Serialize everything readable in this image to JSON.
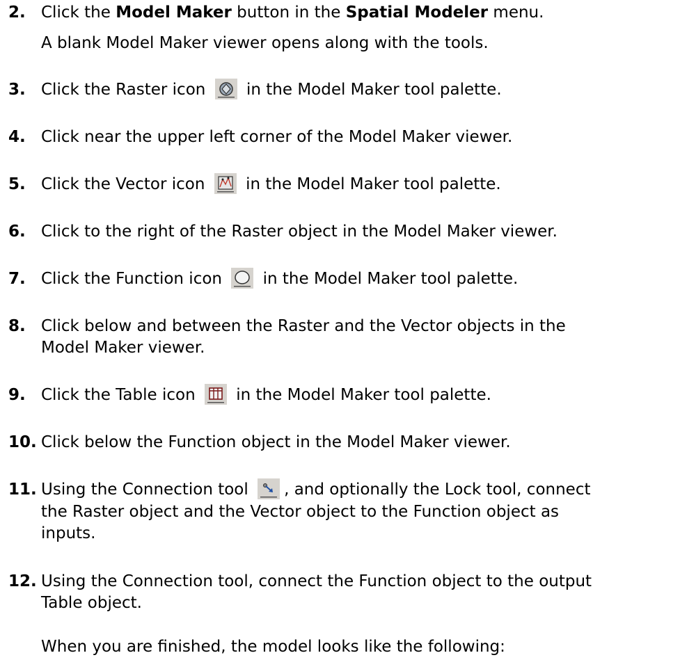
{
  "steps": [
    {
      "num": "2.",
      "pre": "Click the ",
      "b1": "Model Maker",
      "mid": " button in the ",
      "b2": "Spatial Modeler",
      "post": " menu."
    },
    {
      "num": "3.",
      "pre": "Click the Raster icon",
      "icon": "raster-icon",
      "post": "in the Model Maker tool palette."
    },
    {
      "num": "4.",
      "text": "Click near the upper left corner of the Model Maker viewer."
    },
    {
      "num": "5.",
      "pre": "Click the Vector icon",
      "icon": "vector-icon",
      "post": "in the Model Maker tool palette."
    },
    {
      "num": "6.",
      "text": "Click to the right of the Raster object in the Model Maker viewer."
    },
    {
      "num": "7.",
      "pre": "Click the Function icon",
      "icon": "function-icon",
      "post": "in the Model Maker tool palette."
    },
    {
      "num": "8.",
      "line1": "Click below and between the Raster and the Vector objects in the",
      "line2": "Model Maker viewer."
    },
    {
      "num": "9.",
      "pre": "Click the Table icon",
      "icon": "table-icon",
      "post": "in the Model Maker tool palette."
    },
    {
      "num": "10.",
      "text": "Click below the Function object in the Model Maker viewer."
    },
    {
      "num": "11.",
      "pre": "Using the Connection tool",
      "icon": "connection-icon",
      "post": ", and optionally the Lock tool, connect",
      "line2": "the Raster object and the Vector object to the Function object as",
      "line3": "inputs."
    },
    {
      "num": "12.",
      "line1": "Using the Connection tool, connect the Function object to the output",
      "line2": "Table object."
    }
  ],
  "sub2": "A blank Model Maker viewer opens along with the tools.",
  "sub12": "When you are finished, the model looks like the following:"
}
